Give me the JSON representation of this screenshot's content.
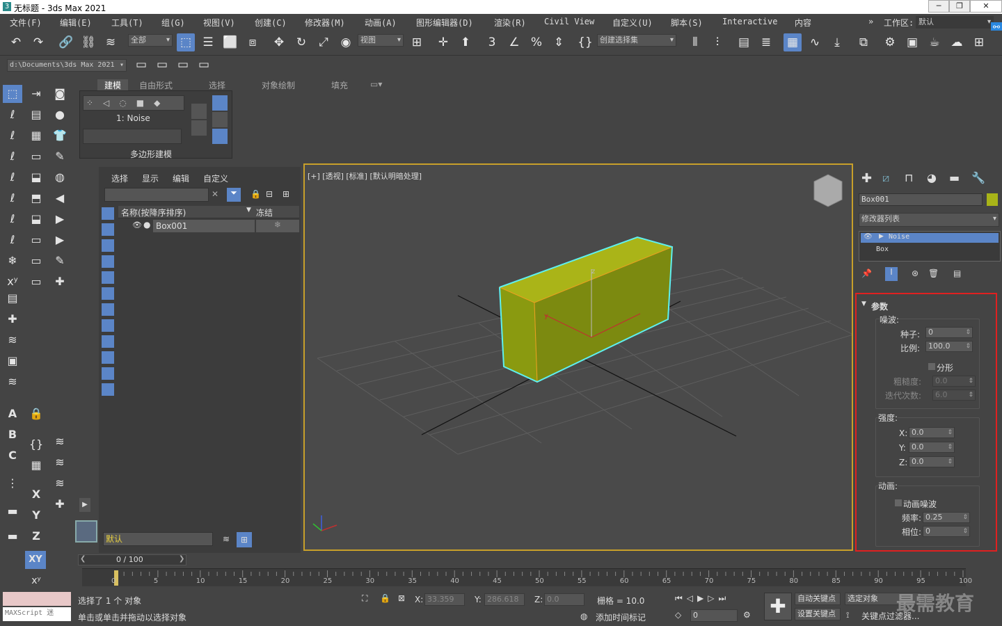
{
  "window": {
    "title": "无标题 - 3ds Max 2021"
  },
  "menu": [
    "文件(F)",
    "编辑(E)",
    "工具(T)",
    "组(G)",
    "视图(V)",
    "创建(C)",
    "修改器(M)",
    "动画(A)",
    "图形编辑器(D)",
    "渲染(R)",
    "Civil View",
    "自定义(U)",
    "脚本(S)",
    "Interactive",
    "内容"
  ],
  "workspace": {
    "label": "工作区:",
    "value": "默认"
  },
  "toolbar": {
    "filter": "全部",
    "refsys": "视图",
    "selset": "创建选择集",
    "path": "d:\\Documents\\3ds Max 2021"
  },
  "ribbon": {
    "tabs": [
      "建模",
      "自由形式",
      "选择",
      "对象绘制",
      "填充"
    ],
    "modifier": "1: Noise",
    "footer": "多边形建模"
  },
  "scene": {
    "menu": [
      "选择",
      "显示",
      "编辑",
      "自定义"
    ],
    "col_name": "名称(按降序排序)",
    "col_freeze": "冻结",
    "object": "Box001",
    "layer": "默认"
  },
  "viewport": {
    "label": "[+] [透视] [标准] [默认明暗处理]"
  },
  "command": {
    "objname": "Box001",
    "modlist": "修改器列表",
    "stack": [
      "Noise",
      "Box"
    ]
  },
  "params": {
    "title": "参数",
    "noise": "噪波:",
    "seed_label": "种子:",
    "seed": "0",
    "scale_label": "比例:",
    "scale": "100.0",
    "fractal": "分形",
    "rough_label": "粗糙度:",
    "rough": "0.0",
    "iter_label": "迭代次数:",
    "iter": "6.0",
    "strength": "强度:",
    "x": "0.0",
    "y": "0.0",
    "z": "0.0",
    "anim": "动画:",
    "anim_noise": "动画噪波",
    "freq_label": "频率:",
    "freq": "0.25",
    "phase_label": "相位:",
    "phase": "0"
  },
  "timeline": {
    "frame": "0 / 100",
    "ticks": [
      "0",
      "5",
      "10",
      "15",
      "20",
      "25",
      "30",
      "35",
      "40",
      "45",
      "50",
      "55",
      "60",
      "65",
      "70",
      "75",
      "80",
      "85",
      "90",
      "95",
      "100"
    ]
  },
  "status": {
    "selected": "选择了 1 个 对象",
    "hint": "单击或单击并拖动以选择对象",
    "x": "33.359",
    "y": "286.618",
    "z": "0.0",
    "grid": "栅格 = 10.0",
    "addtime": "添加时间标记",
    "autokey": "自动关键点",
    "setkey": "设置关键点",
    "selobj": "选定对象",
    "keyfilter": "关键点过滤器...",
    "frameval": "0",
    "maxscript": "MAXScript 迷"
  },
  "watermark": "最需教育"
}
